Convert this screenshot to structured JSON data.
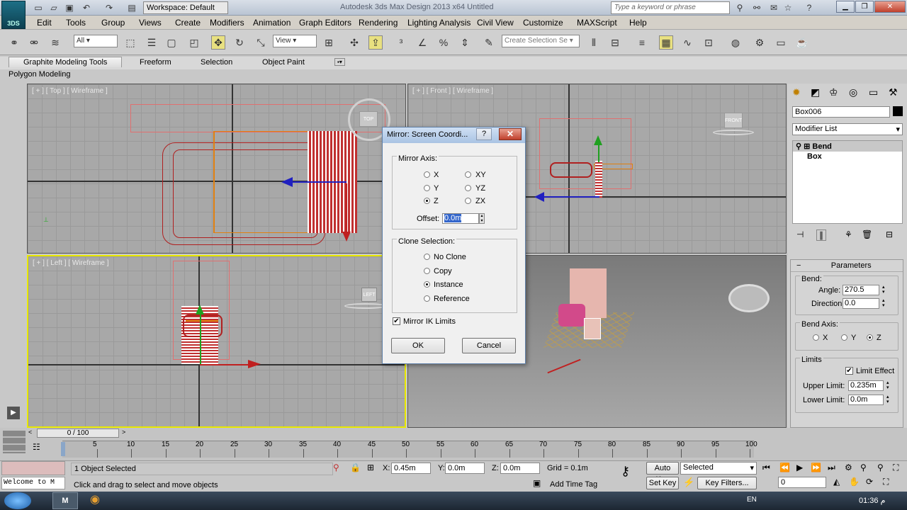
{
  "titlebar": {
    "workspace": "Workspace: Default",
    "app_title": "Autodesk 3ds Max Design 2013 x64     Untitled",
    "search_placeholder": "Type a keyword or phrase",
    "logo": "3DS"
  },
  "menu": [
    "Edit",
    "Tools",
    "Group",
    "Views",
    "Create",
    "Modifiers",
    "Animation",
    "Graph Editors",
    "Rendering",
    "Lighting Analysis",
    "Civil View",
    "Customize",
    "MAXScript",
    "Help"
  ],
  "toolbar": {
    "filter": "All",
    "ref_coord": "View",
    "selection_set": "Create Selection Se"
  },
  "ribbon": {
    "tabs": [
      "Graphite Modeling Tools",
      "Freeform",
      "Selection",
      "Object Paint"
    ],
    "sub": "Polygon Modeling"
  },
  "viewports": {
    "top": "[ + ] [ Top ] [ Wireframe ]",
    "front": "[ + ] [ Front ] [ Wireframe ]",
    "left": "[ + ] [ Left ] [ Wireframe ]",
    "cube_top": "TOP",
    "cube_front": "FRONT",
    "cube_left": "LEFT"
  },
  "dialog": {
    "title": "Mirror: Screen Coordi...",
    "mirror_axis_label": "Mirror Axis:",
    "axes": [
      "X",
      "Y",
      "Z",
      "XY",
      "YZ",
      "ZX"
    ],
    "selected_axis": "Z",
    "offset_label": "Offset:",
    "offset_value": "0.0m",
    "clone_label": "Clone Selection:",
    "clone_options": [
      "No Clone",
      "Copy",
      "Instance",
      "Reference"
    ],
    "selected_clone": "Instance",
    "ik_label": "Mirror IK Limits",
    "ok": "OK",
    "cancel": "Cancel"
  },
  "command_panel": {
    "object_name": "Box006",
    "modifier_list": "Modifier List",
    "stack": [
      "Bend",
      "Box"
    ],
    "parameters_title": "Parameters",
    "bend_label": "Bend:",
    "angle_label": "Angle:",
    "angle_value": "270.5",
    "direction_label": "Direction:",
    "direction_value": "0.0",
    "bend_axis_label": "Bend Axis:",
    "bend_axes": [
      "X",
      "Y",
      "Z"
    ],
    "bend_axis_selected": "Z",
    "limits_label": "Limits",
    "limit_effect_label": "Limit Effect",
    "upper_label": "Upper Limit:",
    "upper_value": "0.235m",
    "lower_label": "Lower Limit:",
    "lower_value": "0.0m"
  },
  "timeline": {
    "frame": "0 / 100",
    "ticks": [
      "5",
      "10",
      "15",
      "20",
      "25",
      "30",
      "35",
      "40",
      "45",
      "50",
      "55",
      "60",
      "65",
      "70",
      "75",
      "80",
      "85",
      "90",
      "95",
      "100"
    ]
  },
  "status": {
    "selected": "1 Object Selected",
    "prompt": "Click and drag to select and move objects",
    "listener": "Welcome to M",
    "x_label": "X:",
    "x": "0.45m",
    "y_label": "Y:",
    "y": "0.0m",
    "z_label": "Z:",
    "z": "0.0m",
    "grid": "Grid = 0.1m",
    "add_time_tag": "Add Time Tag",
    "auto_key": "Auto Key",
    "set_key": "Set Key",
    "key_mode": "Selected",
    "key_filters": "Key Filters...",
    "frame_field": "0"
  },
  "taskbar": {
    "lang": "EN",
    "clock": "01:36  م"
  },
  "colors": {
    "accent_yellow": "#e8e800",
    "selection_red": "#c83030",
    "dialog_blue": "#a9c3e3"
  }
}
